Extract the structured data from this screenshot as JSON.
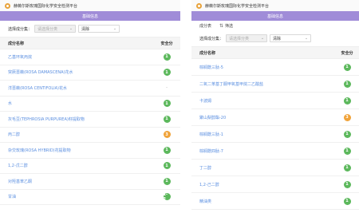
{
  "colors": {
    "accent": "#a08cd8",
    "safe": "#5cb85c",
    "warn": "#f0a33a",
    "link": "#5b8fe0"
  },
  "left": {
    "app_title": "赫薇尔斯玫瑰国际化学安全检测平台",
    "banner": "基础信息",
    "filter": {
      "label": "选择成分集：",
      "collection_placeholder": "请选择分类",
      "sort_label": "清除"
    },
    "table": {
      "col_name": "成分名称",
      "col_safety": "安全分",
      "rows": [
        {
          "name": "乙基环氧丙烷",
          "safety": "1",
          "level": "safe"
        },
        {
          "name": "突厥蔷薇(ROSA DAMASCENA)花水",
          "safety": "1",
          "level": "safe"
        },
        {
          "name": "洋蔷薇(ROSA CENTIFOLIA)花水",
          "safety": "-",
          "level": "none"
        },
        {
          "name": "水",
          "safety": "1",
          "level": "safe"
        },
        {
          "name": "灰毛豆(TEPHROSIA PURPUREA)籽提取物",
          "safety": "1",
          "level": "safe"
        },
        {
          "name": "丙二醇",
          "safety": "3",
          "level": "warn"
        },
        {
          "name": "杂交玫瑰(ROSA HYBRID)花提取物",
          "safety": "1",
          "level": "safe"
        },
        {
          "name": "1,2-戊二醇",
          "safety": "1",
          "level": "safe"
        },
        {
          "name": "对羟基苯乙酮",
          "safety": "1",
          "level": "safe"
        },
        {
          "name": "甘油",
          "safety": "1-2",
          "level": "safe"
        }
      ]
    }
  },
  "right": {
    "app_title": "赫薇尔斯玫瑰国际化学安全检测平台",
    "banner": "基础信息",
    "toolbar": {
      "item1": "成分表",
      "item2": "筛选"
    },
    "filter": {
      "label": "选择成分集：",
      "collection_placeholder": "请选择分类",
      "sort_label": "清除"
    },
    "table": {
      "col_name": "成分名称",
      "col_safety": "安全分",
      "rows": [
        {
          "name": "棕榈酰三肽-5",
          "safety": "1",
          "level": "safe"
        },
        {
          "name": "二氧二苯基丁酮甲氧基甲烷二乙酸盐",
          "safety": "1",
          "level": "safe"
        },
        {
          "name": "卡波姆",
          "safety": "1",
          "level": "safe"
        },
        {
          "name": "聚山梨醇酯-20",
          "safety": "3",
          "level": "warn"
        },
        {
          "name": "棕榈酰三肽-1",
          "safety": "1",
          "level": "safe"
        },
        {
          "name": "棕榈酰四肽-7",
          "safety": "1",
          "level": "safe"
        },
        {
          "name": "丁二醇",
          "safety": "1",
          "level": "safe"
        },
        {
          "name": "1,2-己二醇",
          "safety": "1",
          "level": "safe"
        },
        {
          "name": "精油类",
          "safety": "1",
          "level": "safe"
        }
      ]
    }
  }
}
